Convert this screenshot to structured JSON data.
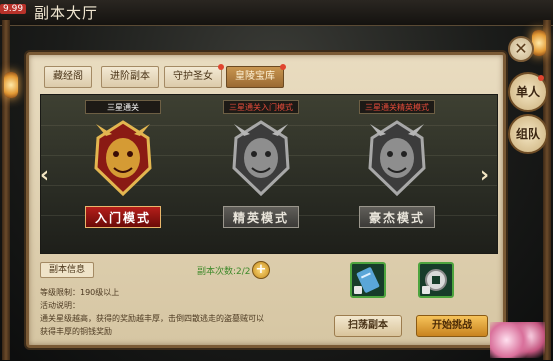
{
  "topbar": {
    "fps": "9.99",
    "title": "副本大厅"
  },
  "tabs": [
    {
      "label": "藏经阁",
      "active": false,
      "red_dot": false
    },
    {
      "label": "进阶副本",
      "active": false,
      "red_dot": false
    },
    {
      "label": "守护圣女",
      "active": false,
      "red_dot": true
    },
    {
      "label": "皇陵宝库",
      "active": true,
      "red_dot": true
    }
  ],
  "modes": [
    {
      "badge": "三星通关",
      "label": "入门模式",
      "selected": true
    },
    {
      "badge": "三星通关入门模式",
      "label": "精英模式",
      "selected": false
    },
    {
      "badge": "三星通关精英模式",
      "label": "豪杰模式",
      "selected": false
    }
  ],
  "info": {
    "title": "副本信息",
    "level_limit": "等级限制：190级以上",
    "desc_label": "活动说明：",
    "desc_line1": "通关星级越高，获得的奖励越丰厚，击倒四散逃走的盗墓贼可以",
    "desc_line2": "获得丰厚的铜钱奖励"
  },
  "count_label": "副本次数:2/2",
  "buttons": {
    "sweep": "扫荡副本",
    "start": "开始挑战"
  },
  "side": {
    "solo": "单人",
    "team": "组队"
  },
  "colors": {
    "frame": "#d6c6a3",
    "active_tab": "#b07a3c",
    "mode_red": "#b51f1a",
    "reward_border": "#4da43e"
  },
  "icons": [
    "close-icon",
    "arrow-left-icon",
    "arrow-right-icon",
    "plus-icon",
    "reward-scroll-icon",
    "reward-coin-icon",
    "lock-icon"
  ]
}
